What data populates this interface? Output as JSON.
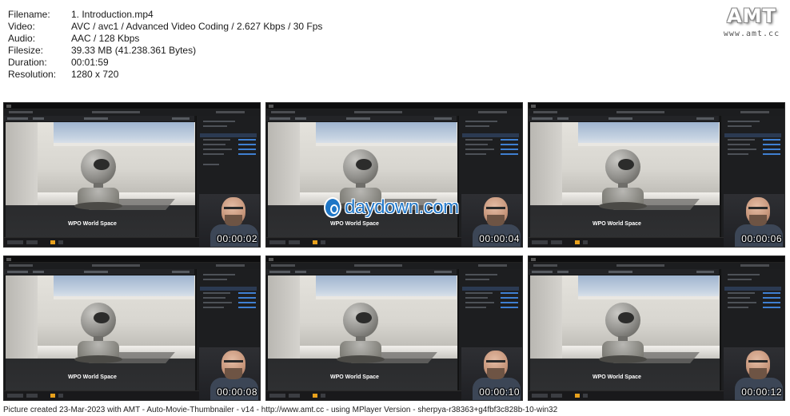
{
  "file_info": [
    {
      "label": "Filename:",
      "value": "1. Introduction.mp4"
    },
    {
      "label": "Video:",
      "value": "AVC / avc1 / Advanced Video Coding / 2.627 Kbps / 30 Fps"
    },
    {
      "label": "Audio:",
      "value": "AAC / 128 Kbps"
    },
    {
      "label": "Filesize:",
      "value": "39.33 MB (41.238.361 Bytes)"
    },
    {
      "label": "Duration:",
      "value": "00:01:59"
    },
    {
      "label": "Resolution:",
      "value": "1280 x 720"
    }
  ],
  "logo": {
    "mark": "AMT",
    "url": "www.amt.cc"
  },
  "thumbnails": [
    {
      "timestamp": "00:00:02",
      "scene_label": "WPO World Space"
    },
    {
      "timestamp": "00:00:04",
      "scene_label": "WPO World Space"
    },
    {
      "timestamp": "00:00:06",
      "scene_label": "WPO World Space"
    },
    {
      "timestamp": "00:00:08",
      "scene_label": "WPO World Space"
    },
    {
      "timestamp": "00:00:10",
      "scene_label": "WPO World Space"
    },
    {
      "timestamp": "00:00:12",
      "scene_label": "WPO World Space"
    }
  ],
  "watermark": {
    "text": "daydown.com"
  },
  "footer": {
    "text": "Picture created 23-Mar-2023 with AMT - Auto-Movie-Thumbnailer - v14 - http://www.amt.cc - using MPlayer Version - sherpya-r38363+g4fbf3c828b-10-win32"
  },
  "colors": {
    "accent_orange": "#e8a11c",
    "watermark_blue": "#2479c9"
  }
}
